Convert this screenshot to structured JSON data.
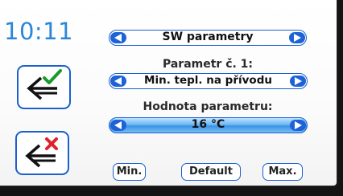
{
  "status": {
    "time": "10:11"
  },
  "menu": {
    "title": "SW parametry"
  },
  "parameter": {
    "caption": "Parametr č. 1:",
    "name": "Min. tepl. na přívodu"
  },
  "value": {
    "caption": "Hodnota parametru:",
    "display": "16 °C"
  },
  "buttons": {
    "min": "Min.",
    "default": "Default",
    "max": "Max."
  },
  "icons": {
    "confirm": "arrow-back-check-icon",
    "cancel": "arrow-back-cross-icon",
    "prev": "triangle-left-icon",
    "next": "triangle-right-icon"
  },
  "colors": {
    "accent": "#1e63d6",
    "clock": "#2a86d8",
    "check": "#1a9a2a",
    "cross": "#e0202a",
    "value_fill": "#3b93e5"
  }
}
